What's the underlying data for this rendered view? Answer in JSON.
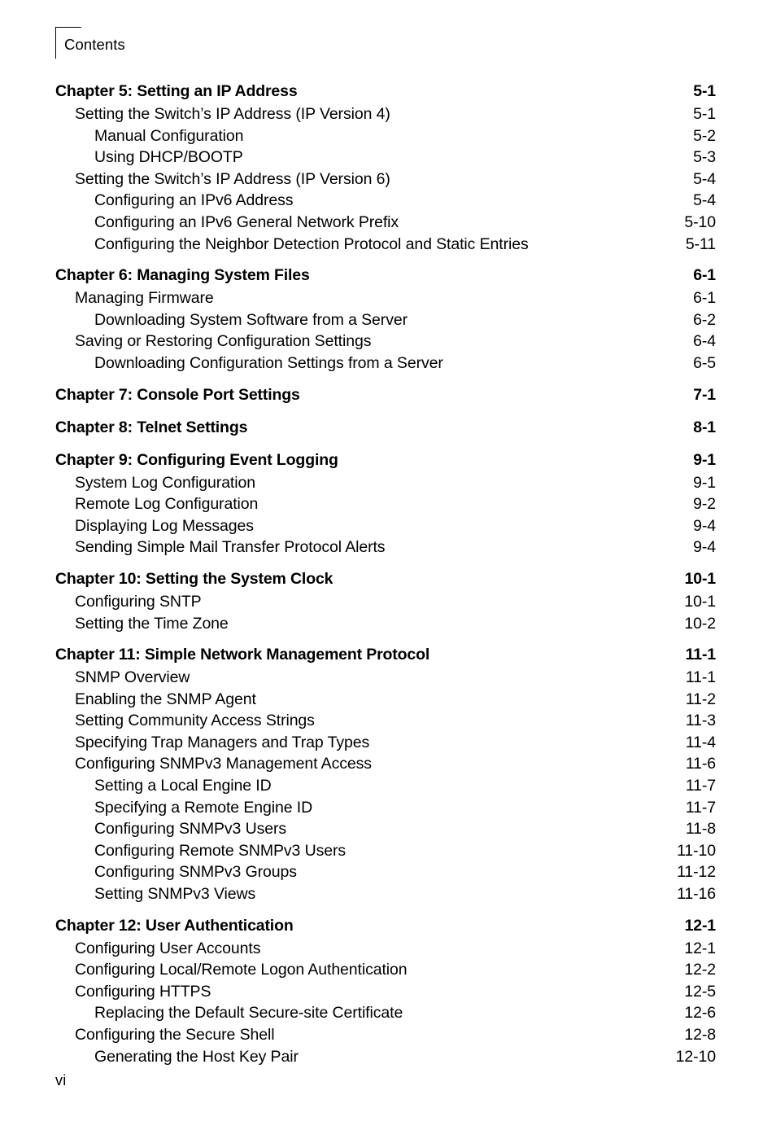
{
  "header": {
    "title": "Contents"
  },
  "footer": {
    "page_number": "vi"
  },
  "toc": {
    "groups": [
      {
        "entries": [
          {
            "level": 0,
            "label": "Chapter 5: Setting an IP Address",
            "page": "5-1"
          },
          {
            "level": 1,
            "label": "Setting the Switch’s IP Address (IP Version 4)",
            "page": "5-1"
          },
          {
            "level": 2,
            "label": "Manual Configuration",
            "page": "5-2"
          },
          {
            "level": 2,
            "label": "Using DHCP/BOOTP",
            "page": "5-3"
          },
          {
            "level": 1,
            "label": "Setting the Switch’s IP Address (IP Version 6)",
            "page": "5-4"
          },
          {
            "level": 2,
            "label": "Configuring an IPv6 Address",
            "page": "5-4"
          },
          {
            "level": 2,
            "label": "Configuring an IPv6 General Network Prefix",
            "page": "5-10"
          },
          {
            "level": 2,
            "label": "Configuring the Neighbor Detection Protocol and Static Entries",
            "page": "5-11"
          }
        ]
      },
      {
        "entries": [
          {
            "level": 0,
            "label": "Chapter 6: Managing System Files",
            "page": "6-1"
          },
          {
            "level": 1,
            "label": "Managing Firmware",
            "page": "6-1"
          },
          {
            "level": 2,
            "label": "Downloading System Software from a Server",
            "page": "6-2"
          },
          {
            "level": 1,
            "label": "Saving or Restoring Configuration Settings",
            "page": "6-4"
          },
          {
            "level": 2,
            "label": "Downloading Configuration Settings from a Server",
            "page": "6-5"
          }
        ]
      },
      {
        "entries": [
          {
            "level": 0,
            "label": "Chapter 7: Console Port Settings",
            "page": "7-1"
          }
        ]
      },
      {
        "entries": [
          {
            "level": 0,
            "label": "Chapter 8: Telnet Settings",
            "page": "8-1"
          }
        ]
      },
      {
        "entries": [
          {
            "level": 0,
            "label": "Chapter 9: Configuring Event Logging",
            "page": "9-1"
          },
          {
            "level": 1,
            "label": "System Log Configuration",
            "page": "9-1"
          },
          {
            "level": 1,
            "label": "Remote Log Configuration",
            "page": "9-2"
          },
          {
            "level": 1,
            "label": "Displaying Log Messages",
            "page": "9-4"
          },
          {
            "level": 1,
            "label": "Sending Simple Mail Transfer Protocol Alerts",
            "page": "9-4"
          }
        ]
      },
      {
        "entries": [
          {
            "level": 0,
            "label": "Chapter 10: Setting the System Clock",
            "page": "10-1"
          },
          {
            "level": 1,
            "label": "Configuring SNTP",
            "page": "10-1"
          },
          {
            "level": 1,
            "label": "Setting the Time Zone",
            "page": "10-2"
          }
        ]
      },
      {
        "entries": [
          {
            "level": 0,
            "label": "Chapter 11: Simple Network Management Protocol",
            "page": "11-1"
          },
          {
            "level": 1,
            "label": "SNMP Overview",
            "page": "11-1"
          },
          {
            "level": 1,
            "label": "Enabling the SNMP Agent",
            "page": "11-2"
          },
          {
            "level": 1,
            "label": "Setting Community Access Strings",
            "page": "11-3"
          },
          {
            "level": 1,
            "label": "Specifying Trap Managers and Trap Types",
            "page": "11-4"
          },
          {
            "level": 1,
            "label": "Configuring SNMPv3 Management Access",
            "page": "11-6"
          },
          {
            "level": 2,
            "label": "Setting a Local Engine ID",
            "page": "11-7"
          },
          {
            "level": 2,
            "label": "Specifying a Remote Engine ID",
            "page": "11-7"
          },
          {
            "level": 2,
            "label": "Configuring SNMPv3 Users",
            "page": "11-8"
          },
          {
            "level": 2,
            "label": "Configuring Remote SNMPv3 Users",
            "page": "11-10"
          },
          {
            "level": 2,
            "label": "Configuring SNMPv3 Groups",
            "page": "11-12"
          },
          {
            "level": 2,
            "label": "Setting SNMPv3 Views",
            "page": "11-16"
          }
        ]
      },
      {
        "entries": [
          {
            "level": 0,
            "label": "Chapter 12: User Authentication",
            "page": "12-1"
          },
          {
            "level": 1,
            "label": "Configuring User Accounts",
            "page": "12-1"
          },
          {
            "level": 1,
            "label": "Configuring Local/Remote Logon Authentication",
            "page": "12-2"
          },
          {
            "level": 1,
            "label": "Configuring HTTPS",
            "page": "12-5"
          },
          {
            "level": 2,
            "label": "Replacing the Default Secure-site Certificate",
            "page": "12-6"
          },
          {
            "level": 1,
            "label": "Configuring the Secure Shell",
            "page": "12-8"
          },
          {
            "level": 2,
            "label": "Generating the Host Key Pair",
            "page": "12-10"
          }
        ]
      }
    ]
  }
}
